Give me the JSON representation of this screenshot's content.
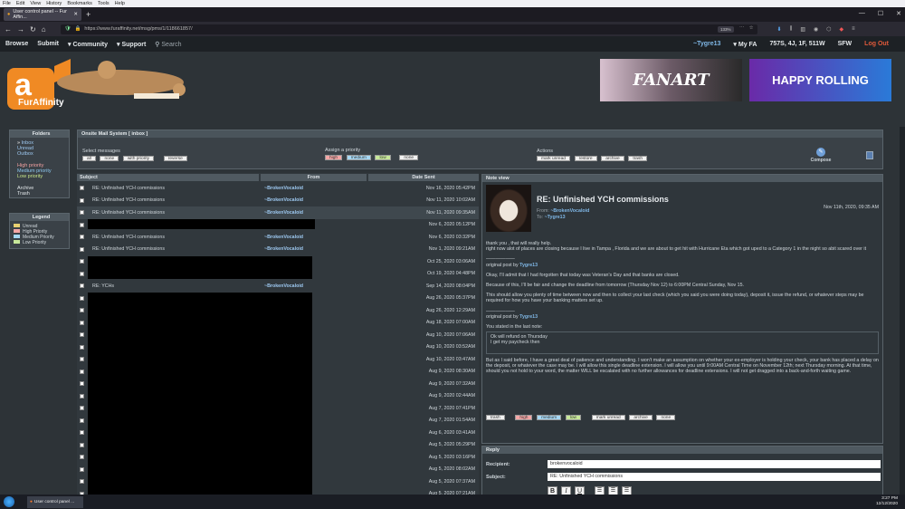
{
  "browser": {
    "menu": [
      "File",
      "Edit",
      "View",
      "History",
      "Bookmarks",
      "Tools",
      "Help"
    ],
    "tab_title": "User control panel -- Fur Affin...",
    "url": "https://www.furaffinity.net/msg/pms/1/118661857/",
    "zoom": "133%"
  },
  "site_nav": {
    "left": [
      "Browse",
      "Submit",
      "Community",
      "Support"
    ],
    "search": "Search",
    "user": "~Tygre13",
    "myfa": "My FA",
    "counts": "757S, 4J, 1F, 511W",
    "sfw": "SFW",
    "logout": "Log Out"
  },
  "banner": {
    "logo_text": "FurAffinity",
    "ad1": "FANART",
    "ad2": "HAPPY ROLLING"
  },
  "folders": {
    "title": "Folders",
    "items": [
      "Inbox",
      "Unread",
      "Outbox"
    ],
    "priority": [
      "High priority",
      "Medium priority",
      "Low priority"
    ],
    "extra": [
      "Archive",
      "Trash"
    ]
  },
  "legend": {
    "title": "Legend",
    "items": [
      "Unread",
      "High Priority",
      "Medium Priority",
      "Low Priority"
    ]
  },
  "toolbar": {
    "title": "Onsite Mail System [ inbox ]",
    "select_label": "Select messages",
    "select_buttons": [
      "all",
      "none",
      "with priority",
      "reverse"
    ],
    "priority_label": "Assign a priority",
    "priority_buttons": [
      "high",
      "medium",
      "low",
      "none"
    ],
    "actions_label": "Actions",
    "action_buttons": [
      "mark unread",
      "restore",
      "archive",
      "trash"
    ],
    "compose": "Compose"
  },
  "table": {
    "headers": [
      "Subject",
      "From",
      "Date Sent"
    ],
    "rows": [
      {
        "subject": "RE: Unfinished YCH commissions",
        "from": "~BrokenVocaloid",
        "date": "Nov 16, 2020 05:42PM"
      },
      {
        "subject": "RE: Unfinished YCH commissions",
        "from": "~BrokenVocaloid",
        "date": "Nov 11, 2020 10:02AM"
      },
      {
        "subject": "RE: Unfinished YCH commissions",
        "from": "~BrokenVocaloid",
        "date": "Nov 11, 2020 09:35AM"
      },
      {
        "subject": "",
        "from": "",
        "date": "Nov 6, 2020 05:12PM"
      },
      {
        "subject": "RE: Unfinished YCH commissions",
        "from": "~BrokenVocaloid",
        "date": "Nov 6, 2020 03:32PM"
      },
      {
        "subject": "RE: Unfinished YCH commissions",
        "from": "~BrokenVocaloid",
        "date": "Nov 1, 2020 09:21AM"
      },
      {
        "subject": "",
        "from": "",
        "date": "Oct 25, 2020 03:06AM"
      },
      {
        "subject": "",
        "from": "",
        "date": "Oct 19, 2020 04:48PM"
      },
      {
        "subject": "RE: YCHs",
        "from": "~BrokenVocaloid",
        "date": "Sep 14, 2020 08:04PM"
      },
      {
        "subject": "",
        "from": "",
        "date": "Aug 26, 2020 05:37PM"
      },
      {
        "subject": "",
        "from": "",
        "date": "Aug 26, 2020 12:29AM"
      },
      {
        "subject": "",
        "from": "",
        "date": "Aug 18, 2020 07:00AM"
      },
      {
        "subject": "",
        "from": "",
        "date": "Aug 10, 2020 07:06AM"
      },
      {
        "subject": "",
        "from": "",
        "date": "Aug 10, 2020 03:52AM"
      },
      {
        "subject": "",
        "from": "",
        "date": "Aug 10, 2020 03:47AM"
      },
      {
        "subject": "",
        "from": "",
        "date": "Aug 9, 2020 08:30AM"
      },
      {
        "subject": "",
        "from": "",
        "date": "Aug 9, 2020 07:32AM"
      },
      {
        "subject": "",
        "from": "",
        "date": "Aug 9, 2020 02:44AM"
      },
      {
        "subject": "",
        "from": "",
        "date": "Aug 7, 2020 07:41PM"
      },
      {
        "subject": "",
        "from": "",
        "date": "Aug 7, 2020 01:54AM"
      },
      {
        "subject": "",
        "from": "",
        "date": "Aug 6, 2020 03:41AM"
      },
      {
        "subject": "",
        "from": "",
        "date": "Aug 5, 2020 05:29PM"
      },
      {
        "subject": "",
        "from": "",
        "date": "Aug 5, 2020 03:16PM"
      },
      {
        "subject": "",
        "from": "",
        "date": "Aug 5, 2020 08:02AM"
      },
      {
        "subject": "",
        "from": "",
        "date": "Aug 5, 2020 07:37AM"
      },
      {
        "subject": "",
        "from": "",
        "date": "Aug 5, 2020 07:21AM"
      }
    ]
  },
  "note": {
    "header": "Note view",
    "subject": "RE: Unfinished YCH commissions",
    "from_label": "From:",
    "from": "~BrokenVocaloid",
    "to_label": "To:",
    "to": "~Tygre13",
    "date": "Nov 11th, 2020, 09:35 AM",
    "para1": "thank you , that will really help.",
    "para2": "right now alot of places are closing because I live in Tampa , Florida and we are about to get hit with Hurricane Eta which got uped to a Category 1 in the night so abit scared over it",
    "sep1": "——————",
    "orig1_label": "original post by",
    "orig1_user": "Tygre13",
    "para3": "Okay, I'll admit that I had forgotten that today was Veteran's Day and that banks are closed.",
    "para4": "Because of this, I'll be fair and change the deadline from tomorrow (Thursday Nov 12) to 6:00PM Central Sunday, Nov 15.",
    "para5": "This should allow you plenty of time between now and then to collect your last check (which you said you were doing today), deposit it, issue the refund, or whatever steps may be required for how you have your banking matters set up.",
    "sep2": "——————",
    "orig2_label": "original post by",
    "orig2_user": "Tygre13",
    "para6": "You stated in the last note:",
    "quote1": "Ok will refund on Thursday",
    "quote2": "I get my paycheck then",
    "para7": "But as I said before, I have a great deal of patience and understanding. I won't make an assumption on whether your ex-employer is holding your check, your bank has placed a delay on the deposit, or whatever the case may be. I will allow this single deadline extension. I will allow you until 9:00AM Central Time on November 12th; next Thursday morning. At that time, should you not hold to your word, the matter WILL be escalated with no further allowances for deadline extensions. I will not get dragged into a back-and-forth waiting game.",
    "buttons": [
      "trash",
      "high",
      "medium",
      "low",
      "mark unread",
      "archive",
      "none"
    ]
  },
  "reply": {
    "header": "Reply",
    "recipient_label": "Recipient:",
    "recipient": "brokenvocaloid",
    "subject_label": "Subject:",
    "subject": "RE: Unfinished YCH commissions",
    "format_buttons": [
      "B",
      "I",
      "U"
    ]
  },
  "taskbar": {
    "app": "User control panel ...",
    "time": "3:27 PM",
    "date": "12/12/2020"
  }
}
